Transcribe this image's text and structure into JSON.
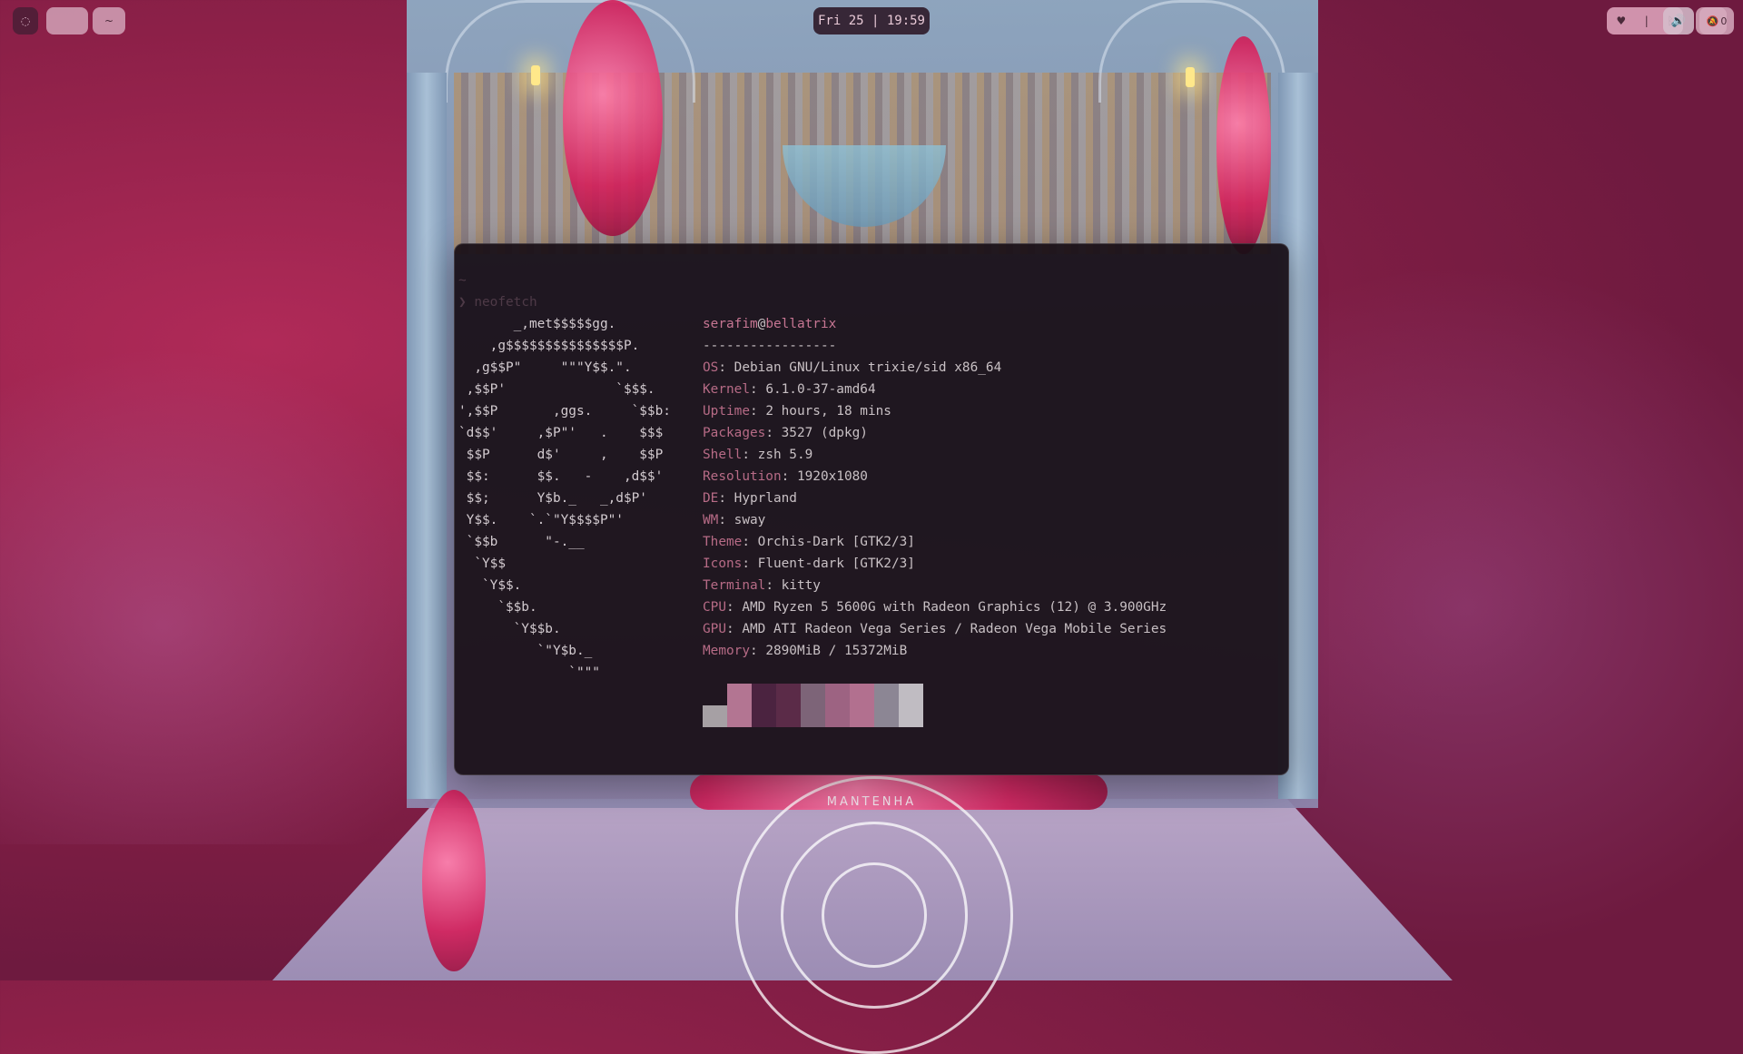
{
  "topbar": {
    "launcher_icon": "circle-icon",
    "workspace_2_label": "~",
    "clock": "Fri 25 | 19:59",
    "status_icons": [
      "heart-icon",
      "bluetooth-icon"
    ],
    "status_separator": "|",
    "volume_icon": "volume-icon",
    "notification_icon": "bell-off-icon",
    "notification_count": "0"
  },
  "terminal": {
    "prompt_dir": "~",
    "prompt_symbol": "❯",
    "command": "neofetch",
    "ascii_art": "       _,met$$$$$gg.\n    ,g$$$$$$$$$$$$$$$P.\n  ,g$$P\"     \"\"\"Y$$.\".\n ,$$P'              `$$$.\n',$$P       ,ggs.     `$$b:\n`d$$'     ,$P\"'   .    $$$\n $$P      d$'     ,    $$P\n $$:      $$.   -    ,d$$'\n $$;      Y$b._   _,d$P'\n Y$$.    `.`\"Y$$$$P\"'\n `$$b      \"-.__\n  `Y$$\n   `Y$$.\n     `$$b.\n       `Y$$b.\n          `\"Y$b._\n              `\"\"\"",
    "user": "serafim",
    "at": "@",
    "host": "bellatrix",
    "separator": "-----------------",
    "info": [
      {
        "key": "OS",
        "value": "Debian GNU/Linux trixie/sid x86_64"
      },
      {
        "key": "Kernel",
        "value": "6.1.0-37-amd64"
      },
      {
        "key": "Uptime",
        "value": "2 hours, 18 mins"
      },
      {
        "key": "Packages",
        "value": "3527 (dpkg)"
      },
      {
        "key": "Shell",
        "value": "zsh 5.9"
      },
      {
        "key": "Resolution",
        "value": "1920x1080"
      },
      {
        "key": "DE",
        "value": "Hyprland"
      },
      {
        "key": "WM",
        "value": "sway"
      },
      {
        "key": "Theme",
        "value": "Orchis-Dark [GTK2/3]"
      },
      {
        "key": "Icons",
        "value": "Fluent-dark [GTK2/3]"
      },
      {
        "key": "Terminal",
        "value": "kitty"
      },
      {
        "key": "CPU",
        "value": "AMD Ryzen 5 5600G with Radeon Graphics (12) @ 3.900GHz"
      },
      {
        "key": "GPU",
        "value": "AMD ATI Radeon Vega Series / Radeon Vega Mobile Series"
      },
      {
        "key": "Memory",
        "value": "2890MiB / 15372MiB"
      }
    ],
    "palette": [
      "#a6a0a4",
      "#b37592",
      "#4b2340",
      "#5b2b48",
      "#7d6478",
      "#9d6382",
      "#b2708f",
      "#8c8694",
      "#c0bcc2"
    ]
  },
  "wallpaper": {
    "sign_text": "MANTENHA"
  }
}
